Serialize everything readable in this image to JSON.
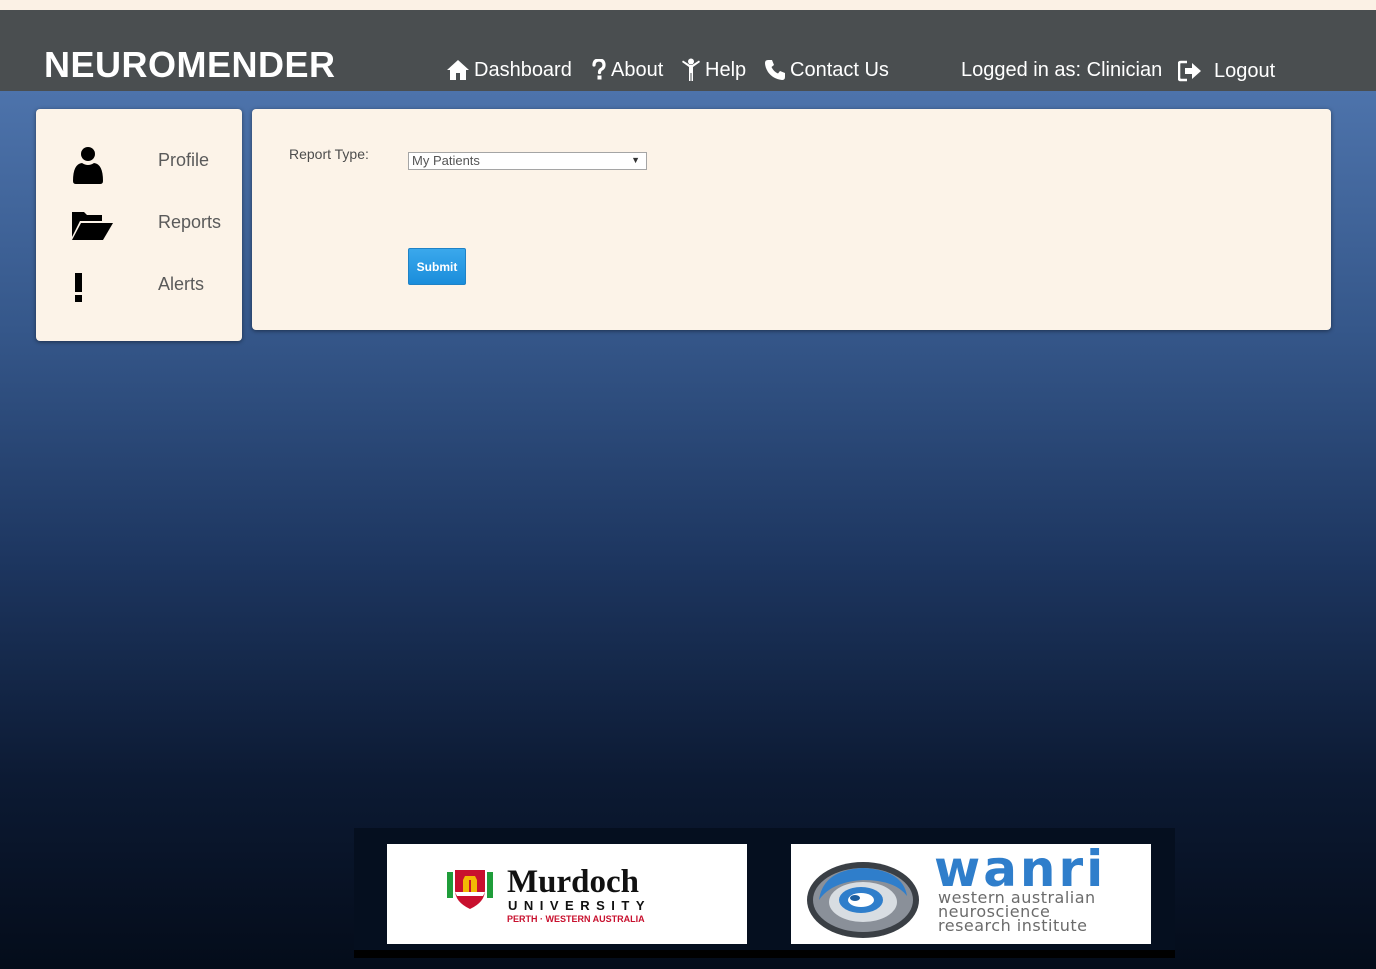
{
  "app": {
    "title": "NEUROMENDER"
  },
  "nav": {
    "dashboard": "Dashboard",
    "about": "About",
    "help": "Help",
    "contact": "Contact Us",
    "logged_in": "Logged in as: Clinician",
    "logout": "Logout"
  },
  "sidebar": {
    "items": [
      {
        "label": "Profile",
        "icon": "user-icon"
      },
      {
        "label": "Reports",
        "icon": "folder-open-icon"
      },
      {
        "label": "Alerts",
        "icon": "exclamation-icon"
      }
    ]
  },
  "form": {
    "report_type_label": "Report Type:",
    "report_type_value": "My Patients",
    "submit_label": "Submit"
  },
  "footer": {
    "murdoch": {
      "name": "Murdoch",
      "sub": "UNIVERSITY",
      "location": "PERTH · WESTERN AUSTRALIA"
    },
    "wanri": {
      "name": "wanri",
      "line1": "western australian",
      "line2": "neuroscience",
      "line3": "research institute"
    }
  },
  "colors": {
    "header_bg": "#4a4e50",
    "panel_bg": "#fcf3e8",
    "button_blue": "#2a9ae3",
    "murdoch_red": "#c8102e",
    "wanri_blue": "#2f7ecb"
  }
}
